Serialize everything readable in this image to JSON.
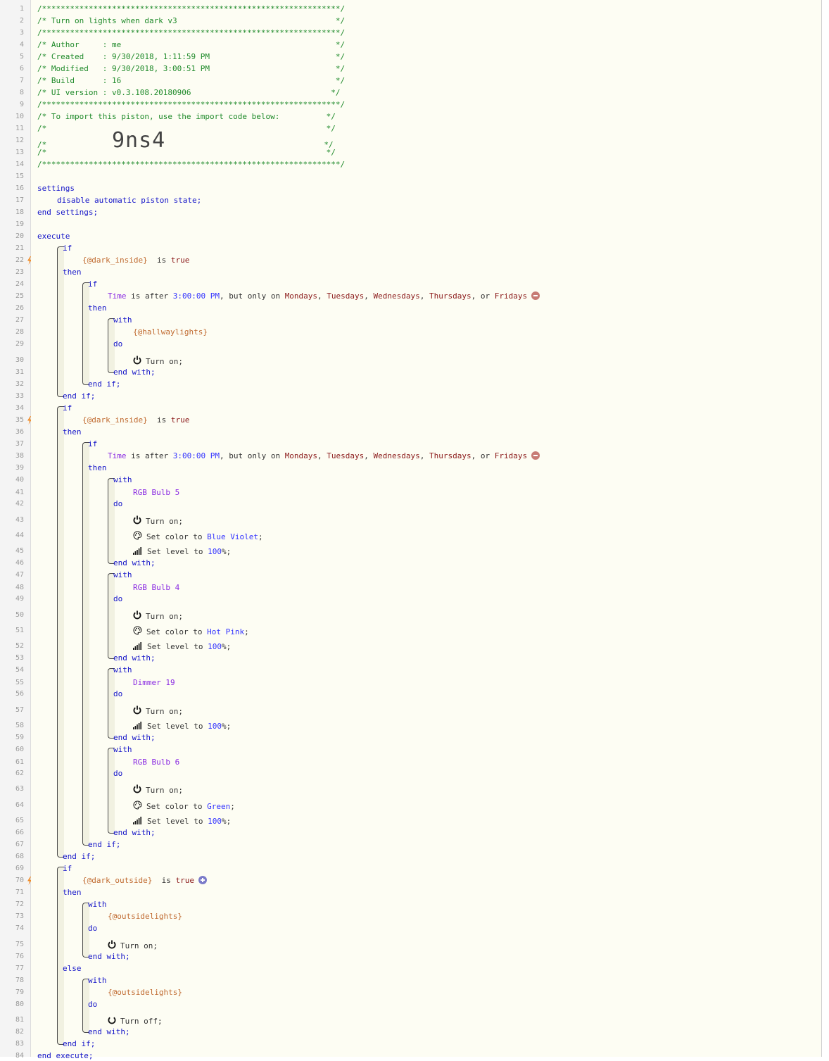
{
  "header": {
    "border": "/****************************************************************/",
    "title_line": "/* Turn on lights when dark v3                                  */",
    "author": "/* Author     : me                                              */",
    "created": "/* Created    : 9/30/2018, 1:11:59 PM                           */",
    "modified": "/* Modified   : 9/30/2018, 3:00:51 PM                           */",
    "build": "/* Build      : 16                                              */",
    "ui_version": "/* UI version : v0.3.108.20180906                              */",
    "import_note": "/* To import this piston, use the import code below:          */",
    "blank": "/*                                                            */",
    "code_prefix": "/*              ",
    "import_code": "9ns4",
    "code_suffix": "                                  */"
  },
  "kw": {
    "settings": "settings",
    "end_settings": "end settings;",
    "execute": "execute",
    "end_execute": "end execute;",
    "if": "if",
    "then": "then",
    "else": "else",
    "end_if": "end if;",
    "with": "with",
    "do": "do",
    "end_with": "end with;",
    "is": "is",
    "true": "true"
  },
  "settings_line": "disable automatic piston state;",
  "vars": {
    "dark_inside": "{@dark_inside}",
    "dark_outside": "{@dark_outside}",
    "hallway": "{@hallwaylights}",
    "outside": "{@outsidelights}"
  },
  "time_cond": {
    "subject": "Time",
    "is_after": " is after ",
    "time": "3:00:00 PM",
    "but_only": ", but only on ",
    "days": [
      "Mondays",
      "Tuesdays",
      "Wednesdays",
      "Thursdays",
      "Fridays"
    ],
    "comma": ", ",
    "or": ", or "
  },
  "devices": {
    "rgb5": "RGB Bulb 5",
    "rgb4": "RGB Bulb 4",
    "dimmer19": "Dimmer 19",
    "rgb6": "RGB Bulb 6"
  },
  "cmd": {
    "turn_on": "Turn on;",
    "turn_off": "Turn off;",
    "set_color": "Set color to ",
    "set_level": "Set level to ",
    "semi": ";",
    "pct_semi": "%;"
  },
  "colors": {
    "blue_violet": "Blue Violet",
    "hot_pink": "Hot Pink",
    "green": "Green"
  },
  "level": "100",
  "line_numbers": [
    "1",
    "2",
    "3",
    "4",
    "5",
    "6",
    "7",
    "8",
    "9",
    "10",
    "11",
    "12",
    "13",
    "14",
    "15",
    "16",
    "17",
    "18",
    "19",
    "20",
    "21",
    "22",
    "23",
    "24",
    "25",
    "26",
    "27",
    "28",
    "29",
    "30",
    "31",
    "32",
    "33",
    "34",
    "35",
    "36",
    "37",
    "38",
    "39",
    "40",
    "41",
    "42",
    "43",
    "44",
    "45",
    "46",
    "47",
    "48",
    "49",
    "50",
    "51",
    "52",
    "53",
    "54",
    "55",
    "56",
    "57",
    "58",
    "59",
    "60",
    "61",
    "62",
    "63",
    "64",
    "65",
    "66",
    "67",
    "68",
    "69",
    "70",
    "71",
    "72",
    "73",
    "74",
    "75",
    "76",
    "77",
    "78",
    "79",
    "80",
    "81",
    "82",
    "83",
    "84"
  ],
  "icons": {
    "power": "power-icon",
    "power_off": "power-off-icon",
    "palette": "palette-icon",
    "level": "signal-level-icon",
    "bolt": "lightning-bolt-icon",
    "remove": "remove-badge-icon",
    "add": "add-badge-icon"
  }
}
